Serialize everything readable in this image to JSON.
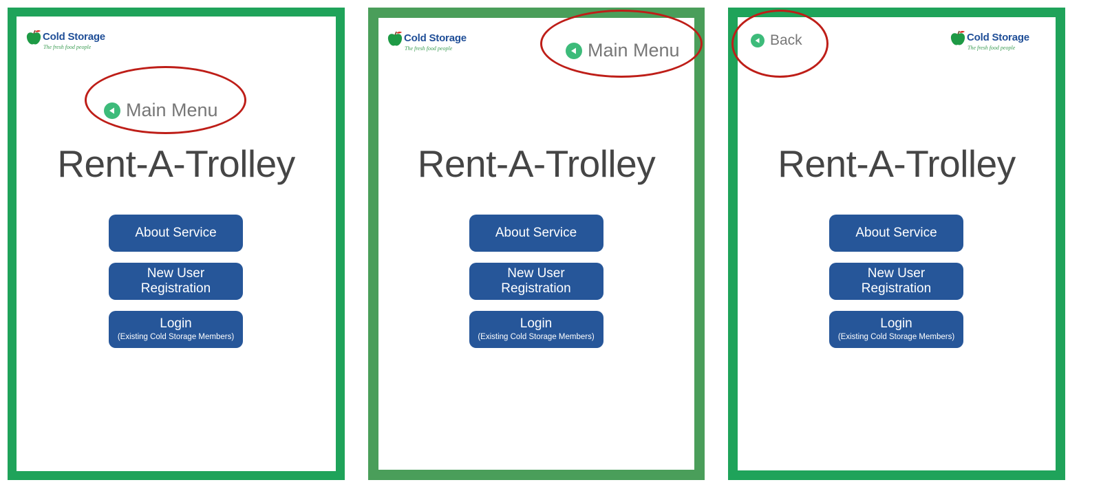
{
  "brand": {
    "name": "Cold Storage",
    "tagline": "The fresh food people",
    "colors": {
      "frame_green": "#1fa35a",
      "frame_green_alt": "#4a9e5a",
      "button_blue": "#265699",
      "highlight_red": "#be1e18",
      "nav_icon_green": "#3dbb7a"
    }
  },
  "screens": [
    {
      "nav": {
        "label": "Main Menu",
        "icon": "back-arrow-icon"
      },
      "title": "Rent-A-Trolley",
      "buttons": {
        "about": "About Service",
        "register_line1": "New User",
        "register_line2": "Registration",
        "login": "Login",
        "login_sub": "(Existing Cold Storage Members)"
      }
    },
    {
      "nav": {
        "label": "Main Menu",
        "icon": "back-arrow-icon"
      },
      "title": "Rent-A-Trolley",
      "buttons": {
        "about": "About Service",
        "register_line1": "New User",
        "register_line2": "Registration",
        "login": "Login",
        "login_sub": "(Existing Cold Storage Members)"
      }
    },
    {
      "nav": {
        "label": "Back",
        "icon": "back-arrow-icon"
      },
      "title": "Rent-A-Trolley",
      "buttons": {
        "about": "About Service",
        "register_line1": "New User",
        "register_line2": "Registration",
        "login": "Login",
        "login_sub": "(Existing Cold Storage Members)"
      }
    }
  ]
}
